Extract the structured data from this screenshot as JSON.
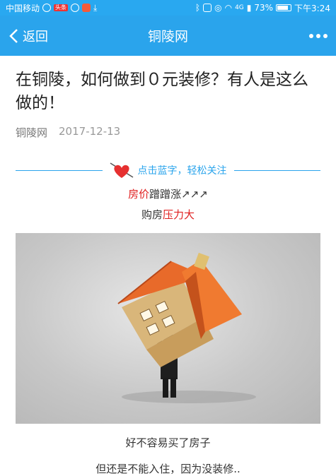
{
  "statusbar": {
    "carrier": "中国移动",
    "toutiao_chip": "头条",
    "network": "4G",
    "battery": "73%",
    "time": "下午3:24"
  },
  "nav": {
    "back_label": "返回",
    "title": "铜陵网"
  },
  "article": {
    "title": "在铜陵，如何做到０元装修？有人是这么做的！",
    "source": "铜陵网",
    "date": "2017-12-13",
    "follow_text": "点击蓝字，轻松关注",
    "line1_emph": "房价",
    "line1_rest": "蹭蹭涨↗↗↗",
    "line2_rest": "购房",
    "line2_emph": "压力大",
    "caption1": "好不容易买了房子",
    "caption2": "但还是不能入住，因为没装修.."
  },
  "colors": {
    "accent": "#2aa4ec",
    "emphasis": "#e02020"
  }
}
